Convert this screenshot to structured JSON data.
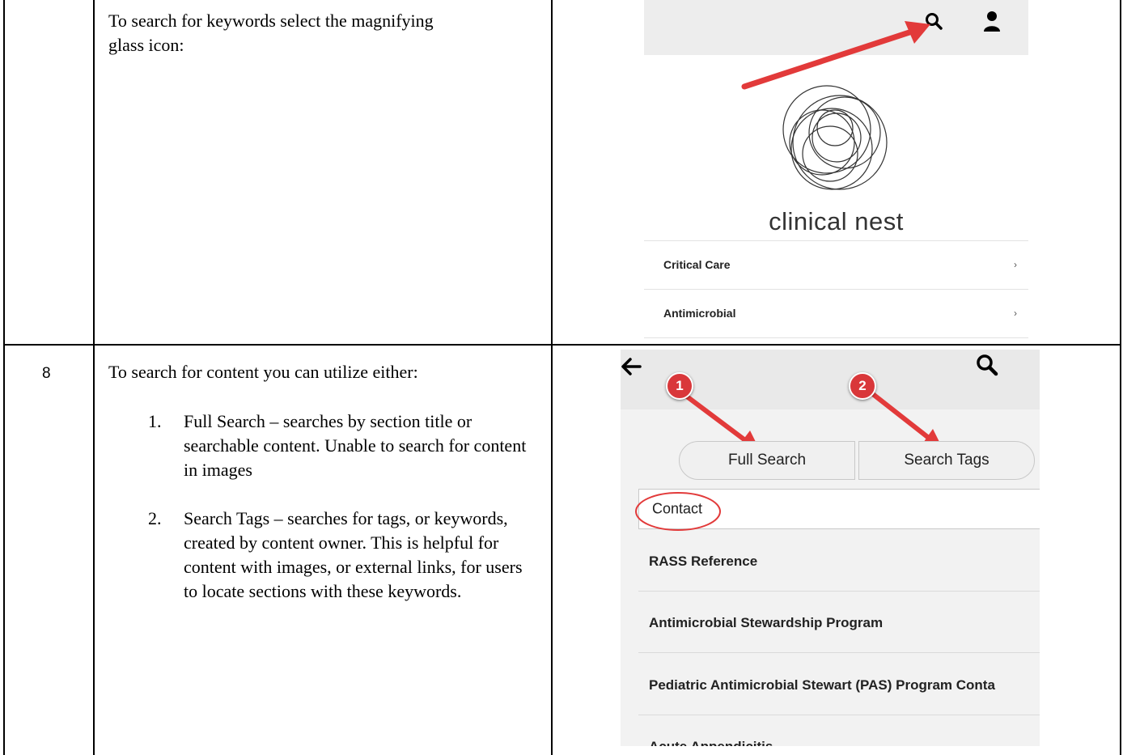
{
  "rows": [
    {
      "number": "",
      "instruction": "To search for keywords select the magnifying glass icon:",
      "screenshot": {
        "icons": [
          "search-icon",
          "user-icon",
          "red-arrow",
          "logo-circles"
        ],
        "brand_name": "clinical nest",
        "menu_items": [
          {
            "label": "Critical Care",
            "chevron": "›"
          },
          {
            "label": "Antimicrobial",
            "chevron": "›"
          }
        ]
      }
    },
    {
      "number": "8",
      "intro": "To search for content you can utilize either:",
      "steps": [
        {
          "num": "1.",
          "text": "Full Search – searches by section title or searchable content. Unable to search for content in images"
        },
        {
          "num": "2.",
          "text": "Search Tags – searches for tags, or keywords, created by content owner. This is helpful for content with images, or external links, for users to locate sections with these keywords."
        }
      ],
      "screenshot": {
        "icons": [
          "back-arrow-icon",
          "search-icon"
        ],
        "badges": [
          "1",
          "2"
        ],
        "tabs": [
          "Full Search",
          "Search Tags"
        ],
        "search_value": "Contact",
        "results": [
          "RASS Reference",
          "Antimicrobial Stewardship Program",
          "Pediatric Antimicrobial Stewart (PAS) Program Conta",
          "Acute Appendicitis"
        ]
      }
    }
  ],
  "colors": {
    "annotation_red": "#e23a3a",
    "badge_red": "#d9373a",
    "header_gray": "#ededed"
  }
}
